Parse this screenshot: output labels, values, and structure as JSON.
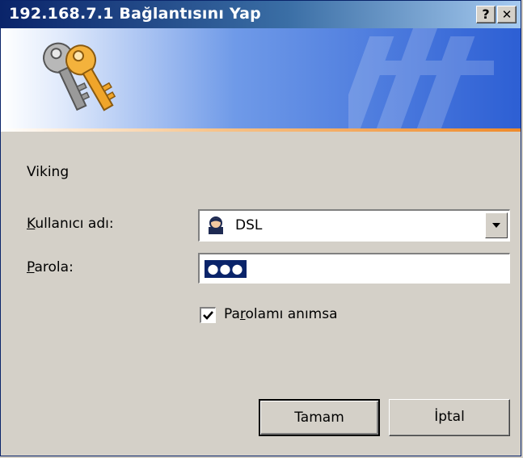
{
  "dialog": {
    "title": "192.168.7.1 Bağlantısını Yap",
    "help_button": "?",
    "close_button": "✕",
    "realm": "Viking",
    "username_label_first": "K",
    "username_label_rest": "ullanıcı adı:",
    "username_value": "DSL",
    "password_label_first": "P",
    "password_label_rest": "arola:",
    "password_masked": "●●●",
    "remember_label_pre": "Pa",
    "remember_label_ul": "r",
    "remember_label_post": "olamı anımsa",
    "remember_checked": true,
    "ok_label": "Tamam",
    "cancel_label": "İptal"
  },
  "icons": {
    "banner": "keys-icon",
    "user": "user-icon",
    "dropdown": "chevron-down-icon"
  },
  "colors": {
    "titlebar": "#0a246a",
    "dialog_bg": "#d4d0c8",
    "banner_accent": "#ef8a2a"
  }
}
